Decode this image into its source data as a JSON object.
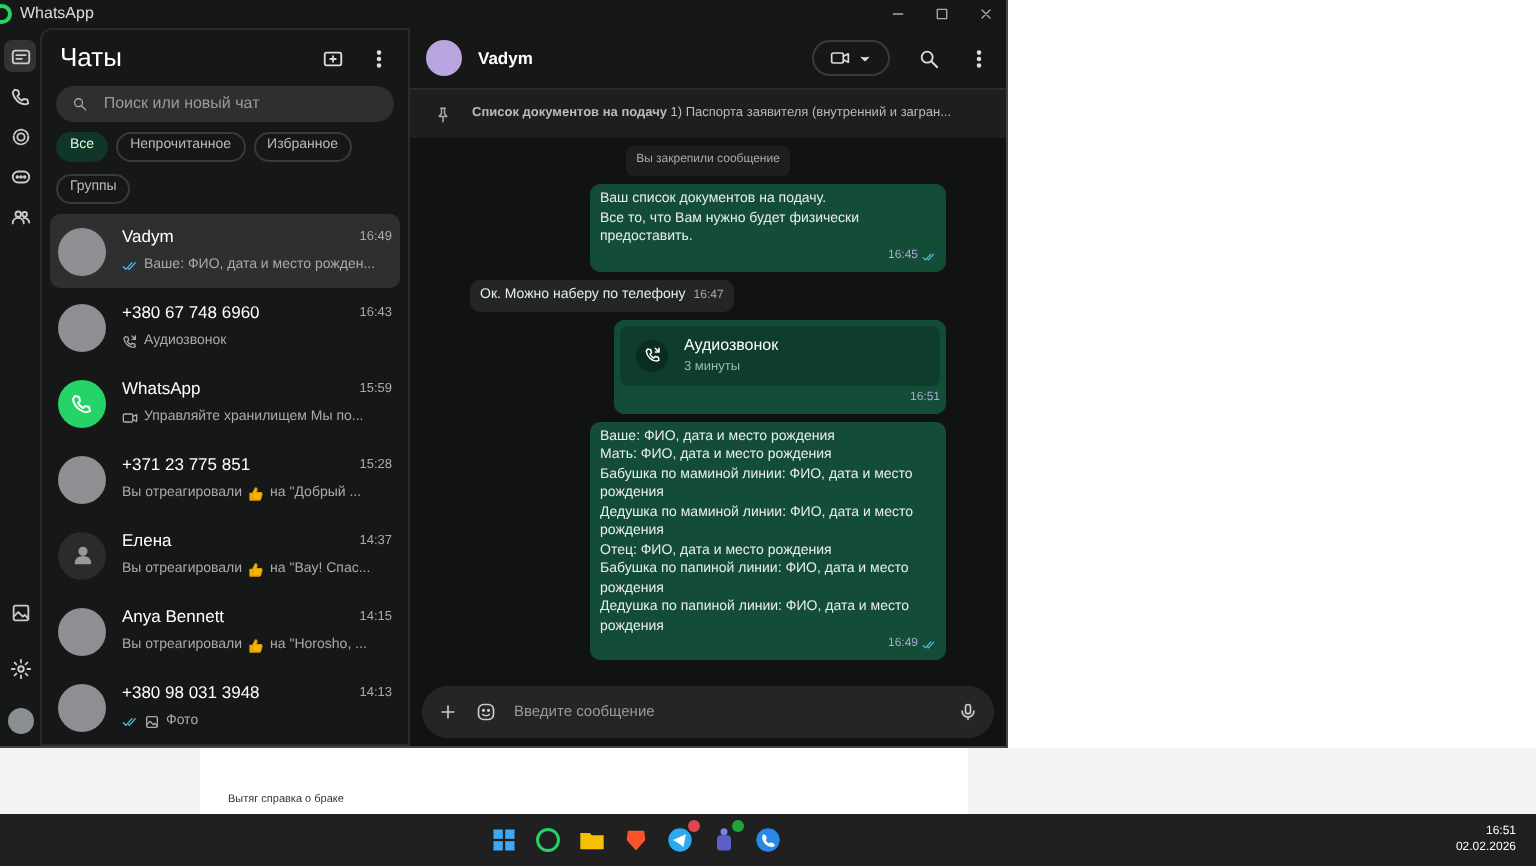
{
  "window": {
    "title": "WhatsApp"
  },
  "rail": {
    "items": [
      {
        "selected": true
      },
      {
        "selected": false
      },
      {
        "selected": false
      },
      {
        "selected": false
      },
      {
        "selected": false
      }
    ],
    "bottom": [
      {
        "selected": false
      },
      {
        "selected": false
      },
      {
        "selected": false
      }
    ]
  },
  "chat_list": {
    "title": "Чаты",
    "search": {
      "placeholder": "Поиск или новый чат"
    },
    "filters": [
      {
        "label": "Все",
        "selected": true
      },
      {
        "label": "Непрочитанное",
        "selected": false
      },
      {
        "label": "Избранное",
        "selected": false
      },
      {
        "label": "Группы",
        "selected": false
      }
    ],
    "chats": [
      {
        "name": "Vadym",
        "time": "16:49",
        "kind": "ticks",
        "preview": "Ваше: ФИО, дата и место рожден...",
        "selected": true
      },
      {
        "name": "+380 67 748 6960",
        "time": "16:43",
        "kind": "call",
        "preview": "Аудиозвонок",
        "selected": false
      },
      {
        "name": "WhatsApp",
        "time": "15:59",
        "kind": "video",
        "preview": "Управляйте хранилищем Мы по...",
        "selected": false
      },
      {
        "name": "+371 23 775 851",
        "time": "15:28",
        "kind": "reaction",
        "preview": "Вы отреагировали",
        "preview_after": "на \"Добрый ...",
        "selected": false
      },
      {
        "name": "Елена",
        "time": "14:37",
        "kind": "reaction",
        "preview": "Вы отреагировали",
        "preview_after": "на \"Вау! Спас...",
        "selected": false
      },
      {
        "name": "Anya Bennett",
        "time": "14:15",
        "kind": "reaction",
        "preview": "Вы отреагировали",
        "preview_after": "на \"Horosho, ...",
        "selected": false
      },
      {
        "name": "+380 98 031 3948",
        "time": "14:13",
        "kind": "photo",
        "preview": "Фото",
        "selected": false
      }
    ]
  },
  "conversation": {
    "contact": "Vadym",
    "pinned": {
      "title": "Список документов на подачу",
      "text": "1) Паспорта заявителя (внутренний и загран..."
    },
    "messages": [
      {
        "kind": "notice",
        "text": "Вы закрепили сообщение"
      },
      {
        "kind": "outgoing",
        "lines": [
          "Ваш список документов на подачу.",
          "Все то, что Вам нужно будет физически предоставить."
        ],
        "time": "16:45",
        "read": true
      },
      {
        "kind": "incoming",
        "lines": [
          "Ок. Можно наберу по телефону"
        ],
        "time": "16:47"
      },
      {
        "kind": "call",
        "title": "Аудиозвонок",
        "duration": "3 минуты",
        "time": "16:51"
      },
      {
        "kind": "outgoing",
        "lines": [
          "Ваше: ФИО, дата и место рождения",
          "Мать: ФИО, дата и место рождения",
          "Бабушка по маминой линии: ФИО, дата и место рождения",
          "Дедушка по маминой линии: ФИО, дата и место рождения",
          "Отец: ФИО, дата и место рождения",
          "Бабушка по папиной линии: ФИО, дата и место рождения",
          "Дедушка по папиной линии: ФИО, дата и место рождения"
        ],
        "time": "16:49",
        "read": true
      }
    ],
    "composer": {
      "placeholder": "Введите сообщение"
    }
  },
  "background_page": {
    "text": "Вытяг справка о браке"
  },
  "taskbar": {
    "time": "16:51",
    "date": "02.02.2026"
  }
}
